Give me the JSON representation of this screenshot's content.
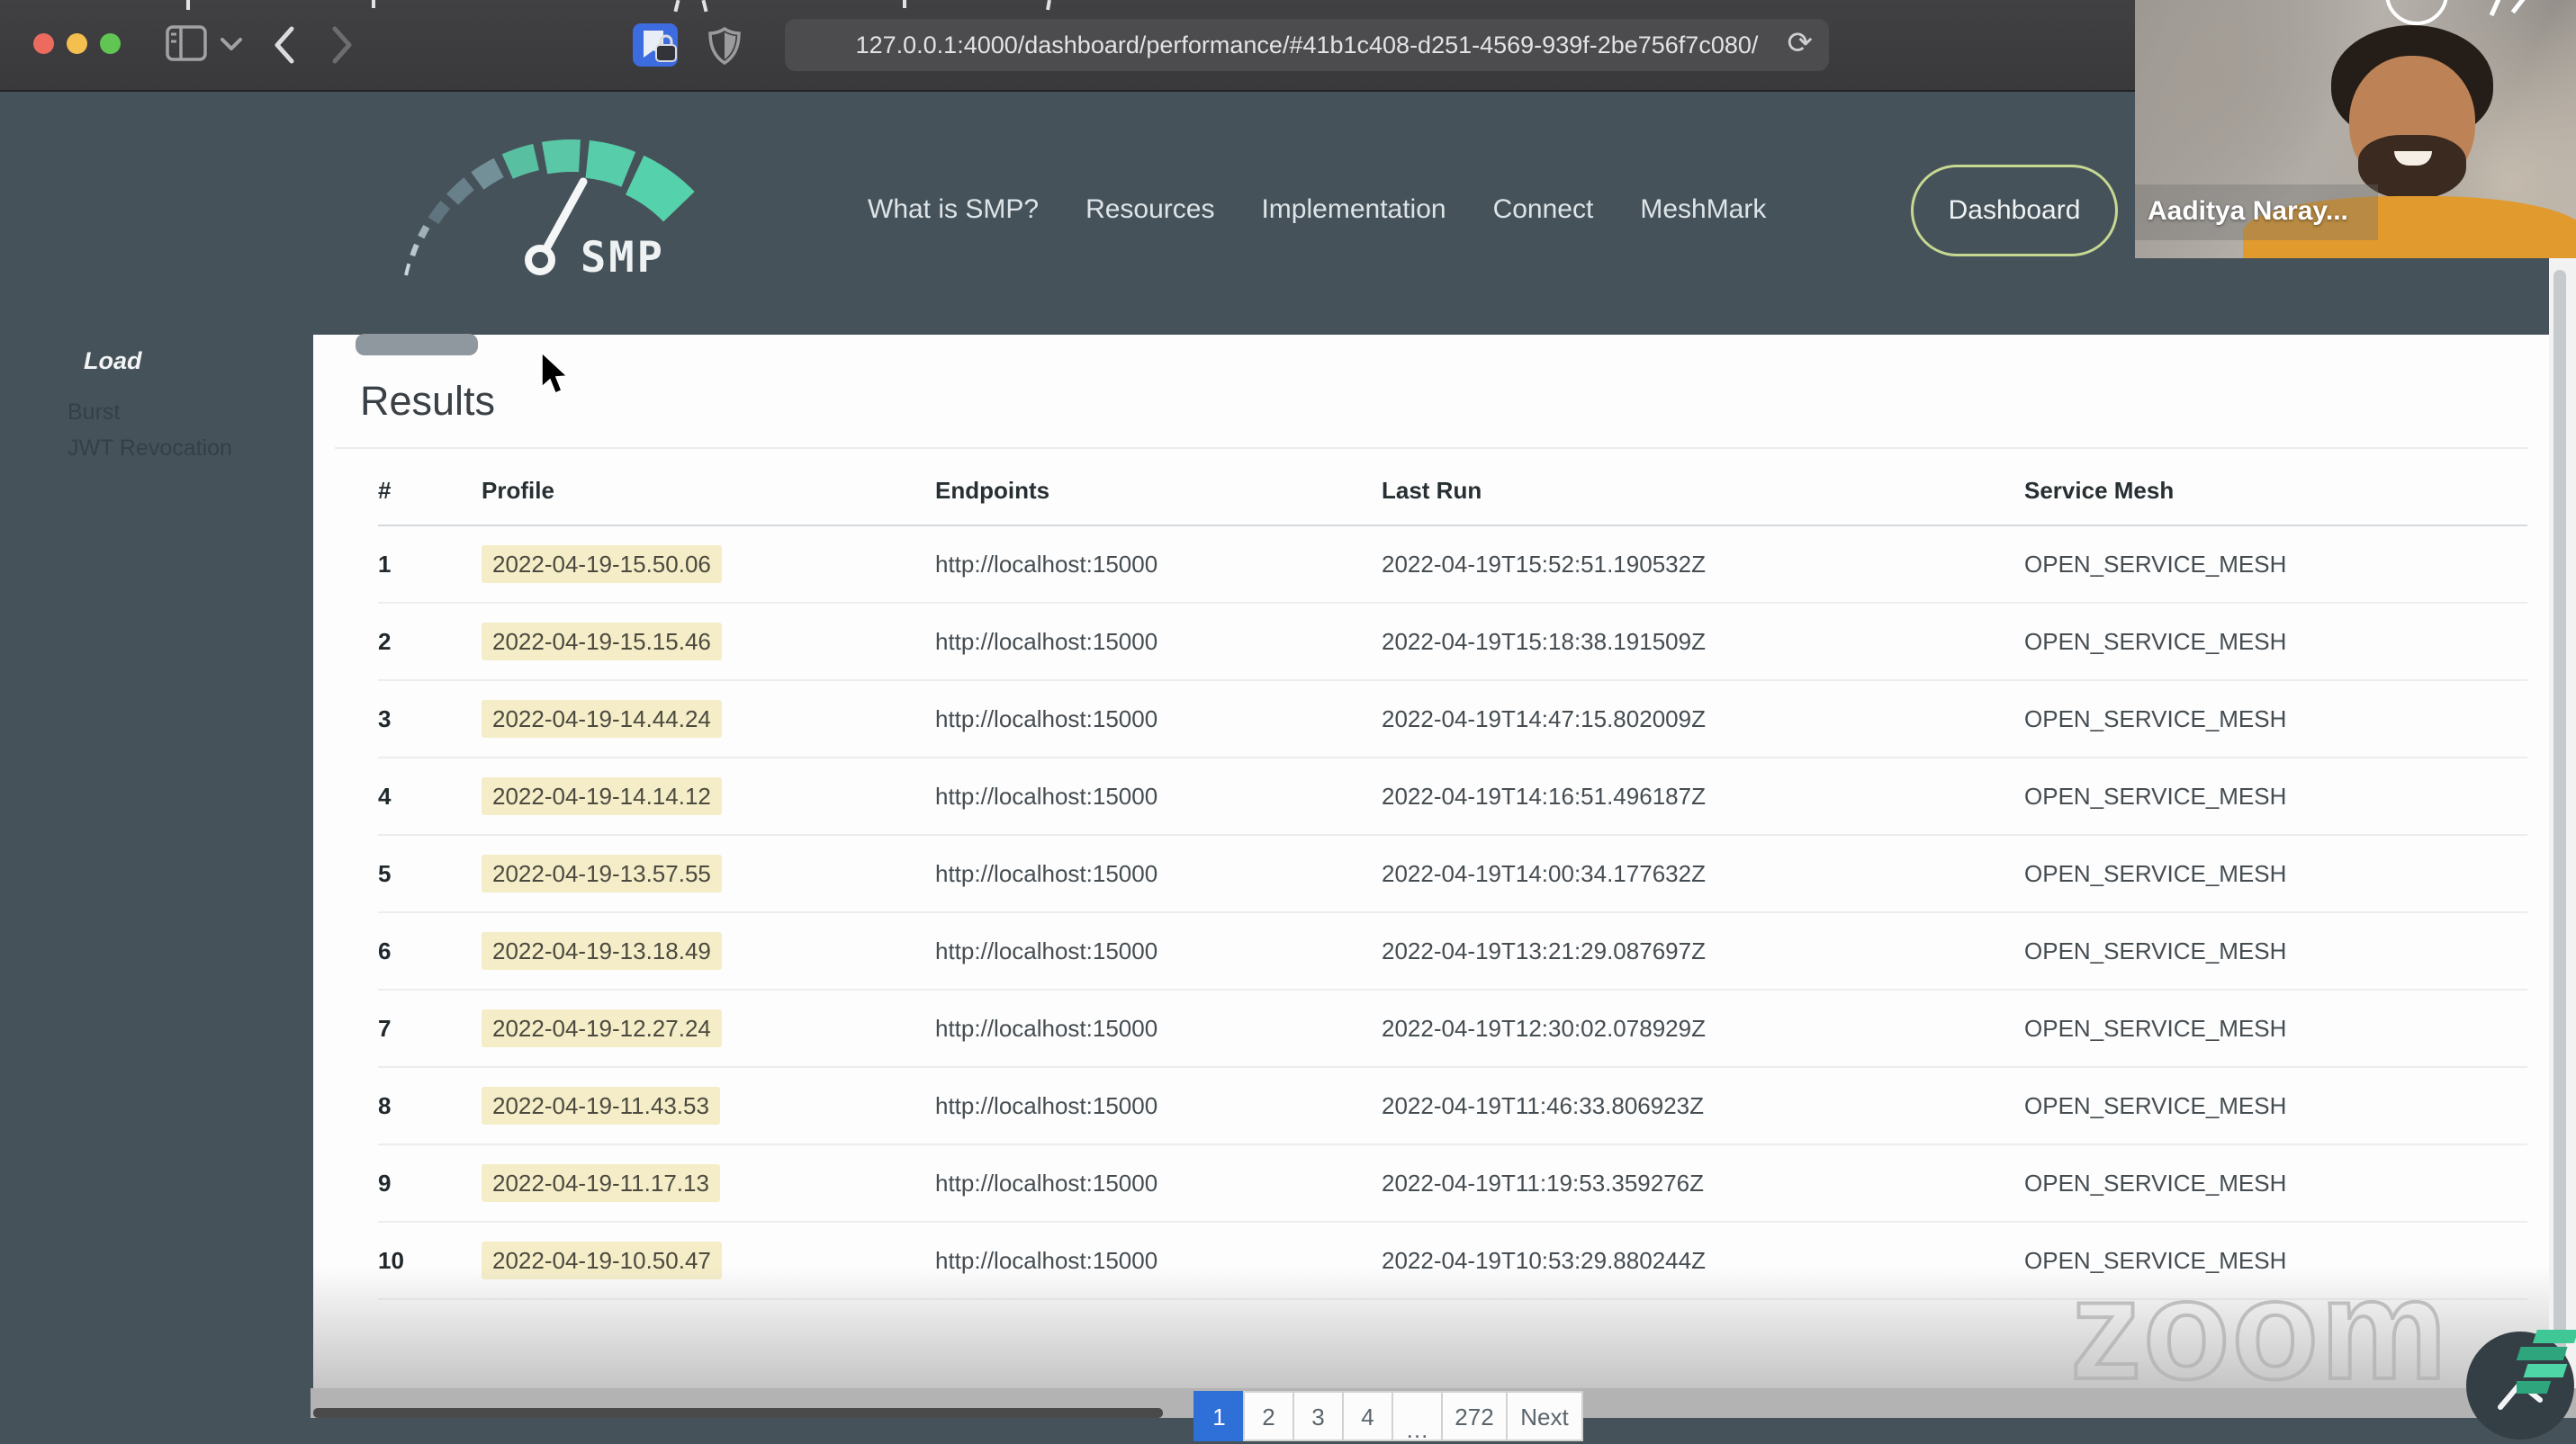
{
  "browser": {
    "url": "127.0.0.1:4000/dashboard/performance/#41b1c408-d251-4569-939f-2be756f7c080/",
    "reload_icon": "⟳"
  },
  "nav": {
    "logo_text": "SMP",
    "items": [
      "What is SMP?",
      "Resources",
      "Implementation",
      "Connect",
      "MeshMark"
    ],
    "dashboard_label": "Dashboard"
  },
  "sidebar": {
    "items": [
      {
        "label": "Load",
        "active": true
      },
      {
        "label": "Burst",
        "active": false
      },
      {
        "label": "JWT Revocation",
        "active": false
      }
    ]
  },
  "main": {
    "results_title": "Results",
    "table": {
      "headers": [
        "#",
        "Profile",
        "Endpoints",
        "Last Run",
        "Service Mesh"
      ],
      "rows": [
        {
          "num": "1",
          "profile": "2022-04-19-15.50.06",
          "endpoints": "http://localhost:15000",
          "last_run": "2022-04-19T15:52:51.190532Z",
          "mesh": "OPEN_SERVICE_MESH"
        },
        {
          "num": "2",
          "profile": "2022-04-19-15.15.46",
          "endpoints": "http://localhost:15000",
          "last_run": "2022-04-19T15:18:38.191509Z",
          "mesh": "OPEN_SERVICE_MESH"
        },
        {
          "num": "3",
          "profile": "2022-04-19-14.44.24",
          "endpoints": "http://localhost:15000",
          "last_run": "2022-04-19T14:47:15.802009Z",
          "mesh": "OPEN_SERVICE_MESH"
        },
        {
          "num": "4",
          "profile": "2022-04-19-14.14.12",
          "endpoints": "http://localhost:15000",
          "last_run": "2022-04-19T14:16:51.496187Z",
          "mesh": "OPEN_SERVICE_MESH"
        },
        {
          "num": "5",
          "profile": "2022-04-19-13.57.55",
          "endpoints": "http://localhost:15000",
          "last_run": "2022-04-19T14:00:34.177632Z",
          "mesh": "OPEN_SERVICE_MESH"
        },
        {
          "num": "6",
          "profile": "2022-04-19-13.18.49",
          "endpoints": "http://localhost:15000",
          "last_run": "2022-04-19T13:21:29.087697Z",
          "mesh": "OPEN_SERVICE_MESH"
        },
        {
          "num": "7",
          "profile": "2022-04-19-12.27.24",
          "endpoints": "http://localhost:15000",
          "last_run": "2022-04-19T12:30:02.078929Z",
          "mesh": "OPEN_SERVICE_MESH"
        },
        {
          "num": "8",
          "profile": "2022-04-19-11.43.53",
          "endpoints": "http://localhost:15000",
          "last_run": "2022-04-19T11:46:33.806923Z",
          "mesh": "OPEN_SERVICE_MESH"
        },
        {
          "num": "9",
          "profile": "2022-04-19-11.17.13",
          "endpoints": "http://localhost:15000",
          "last_run": "2022-04-19T11:19:53.359276Z",
          "mesh": "OPEN_SERVICE_MESH"
        },
        {
          "num": "10",
          "profile": "2022-04-19-10.50.47",
          "endpoints": "http://localhost:15000",
          "last_run": "2022-04-19T10:53:29.880244Z",
          "mesh": "OPEN_SERVICE_MESH"
        }
      ]
    },
    "pagination": {
      "items": [
        {
          "label": "1",
          "active": true
        },
        {
          "label": "2",
          "active": false
        },
        {
          "label": "3",
          "active": false
        },
        {
          "label": "4",
          "active": false
        },
        {
          "label": "…",
          "active": false,
          "ellipsis": true
        },
        {
          "label": "272",
          "active": false,
          "wide": true
        },
        {
          "label": "Next",
          "active": false,
          "next": true
        }
      ]
    }
  },
  "webcam": {
    "name": "Aaditya Naray..."
  },
  "watermark": "zoom",
  "colors": {
    "slate": "#46525A",
    "accent_teal": "#57CDA9",
    "highlight_yellow": "#F4EDC7",
    "active_blue": "#2F6FD8",
    "pill_border": "#C6D892",
    "chrome_gray": "#3B3B3D"
  }
}
